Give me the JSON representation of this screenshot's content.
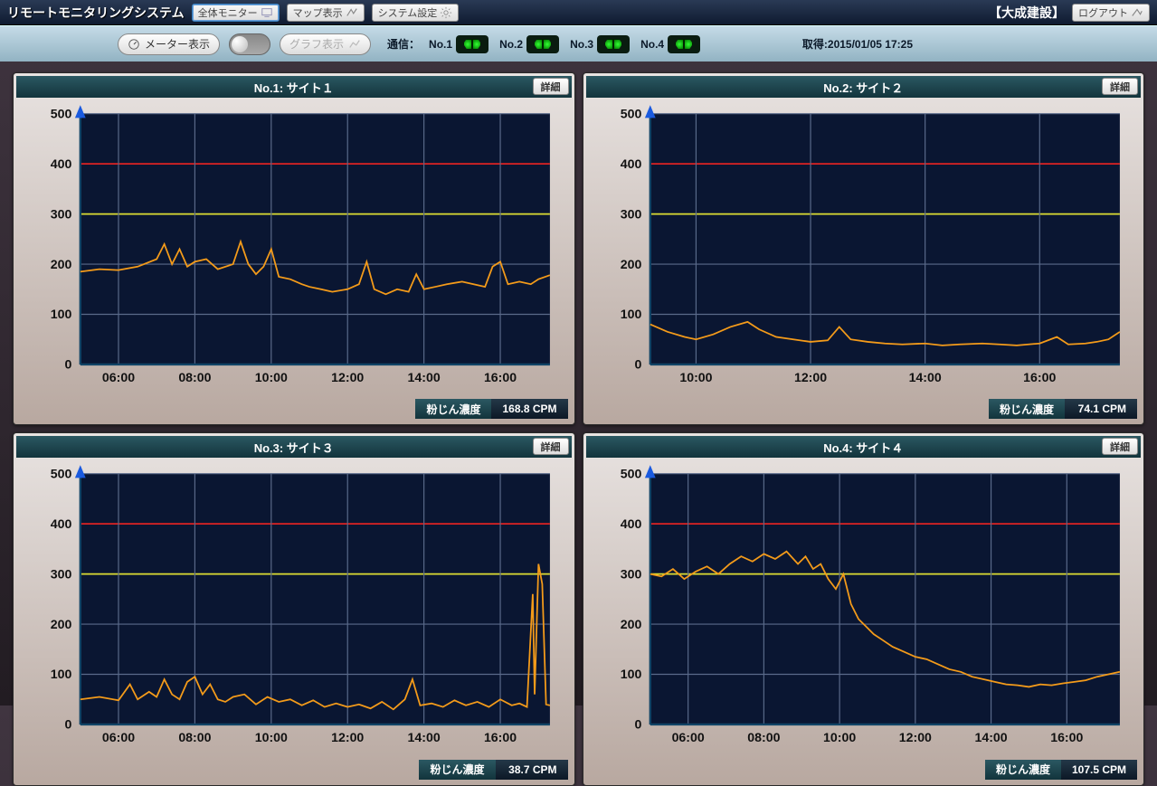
{
  "header": {
    "app_title": "リモートモニタリングシステム",
    "btn_overall": "全体モニター",
    "btn_map": "マップ表示",
    "btn_settings": "システム設定",
    "brand": "【大成建設】",
    "btn_logout": "ログアウト"
  },
  "subbar": {
    "btn_meter": "メーター表示",
    "btn_graph": "グラフ表示",
    "comm_label": "通信：",
    "acq_label": "取得:",
    "acq_time": "2015/01/05 17:25",
    "nodes": [
      {
        "label": "No.1"
      },
      {
        "label": "No.2"
      },
      {
        "label": "No.3"
      },
      {
        "label": "No.4"
      }
    ]
  },
  "panels": [
    {
      "title": "No.1: サイト１",
      "detail": "詳細",
      "metric": "粉じん濃度",
      "value": "168.8 CPM"
    },
    {
      "title": "No.2: サイト２",
      "detail": "詳細",
      "metric": "粉じん濃度",
      "value": "74.1 CPM"
    },
    {
      "title": "No.3: サイト３",
      "detail": "詳細",
      "metric": "粉じん濃度",
      "value": "38.7 CPM"
    },
    {
      "title": "No.4: サイト４",
      "detail": "詳細",
      "metric": "粉じん濃度",
      "value": "107.5 CPM"
    }
  ],
  "chart_data": [
    {
      "type": "line",
      "title": "No.1: サイト１",
      "ylabel": "",
      "xlabel": "",
      "ylim": [
        0,
        500
      ],
      "thresholds": {
        "red": 400,
        "yellow": 300
      },
      "x_ticks": [
        "06:00",
        "08:00",
        "10:00",
        "12:00",
        "14:00",
        "16:00"
      ],
      "series": [
        {
          "name": "dust",
          "data": [
            [
              5.0,
              185
            ],
            [
              5.5,
              190
            ],
            [
              6.0,
              188
            ],
            [
              6.5,
              195
            ],
            [
              7.0,
              210
            ],
            [
              7.2,
              240
            ],
            [
              7.4,
              200
            ],
            [
              7.6,
              230
            ],
            [
              7.8,
              195
            ],
            [
              8.0,
              205
            ],
            [
              8.3,
              210
            ],
            [
              8.6,
              190
            ],
            [
              9.0,
              200
            ],
            [
              9.2,
              245
            ],
            [
              9.4,
              200
            ],
            [
              9.6,
              180
            ],
            [
              9.8,
              195
            ],
            [
              10.0,
              230
            ],
            [
              10.2,
              175
            ],
            [
              10.5,
              170
            ],
            [
              10.8,
              160
            ],
            [
              11.0,
              155
            ],
            [
              11.3,
              150
            ],
            [
              11.6,
              145
            ],
            [
              12.0,
              150
            ],
            [
              12.3,
              160
            ],
            [
              12.5,
              205
            ],
            [
              12.7,
              150
            ],
            [
              13.0,
              140
            ],
            [
              13.3,
              150
            ],
            [
              13.6,
              145
            ],
            [
              13.8,
              180
            ],
            [
              14.0,
              150
            ],
            [
              14.3,
              155
            ],
            [
              14.6,
              160
            ],
            [
              15.0,
              165
            ],
            [
              15.3,
              160
            ],
            [
              15.6,
              155
            ],
            [
              15.8,
              195
            ],
            [
              16.0,
              205
            ],
            [
              16.2,
              160
            ],
            [
              16.5,
              165
            ],
            [
              16.8,
              160
            ],
            [
              17.0,
              170
            ],
            [
              17.3,
              178
            ]
          ]
        }
      ]
    },
    {
      "type": "line",
      "title": "No.2: サイト２",
      "ylabel": "",
      "xlabel": "",
      "ylim": [
        0,
        500
      ],
      "thresholds": {
        "red": 400,
        "yellow": 300
      },
      "x_ticks": [
        "10:00",
        "12:00",
        "14:00",
        "16:00"
      ],
      "series": [
        {
          "name": "dust",
          "data": [
            [
              9.2,
              80
            ],
            [
              9.5,
              65
            ],
            [
              9.8,
              55
            ],
            [
              10.0,
              50
            ],
            [
              10.3,
              60
            ],
            [
              10.6,
              75
            ],
            [
              10.9,
              85
            ],
            [
              11.1,
              70
            ],
            [
              11.4,
              55
            ],
            [
              11.7,
              50
            ],
            [
              12.0,
              45
            ],
            [
              12.3,
              48
            ],
            [
              12.5,
              75
            ],
            [
              12.7,
              50
            ],
            [
              13.0,
              45
            ],
            [
              13.3,
              42
            ],
            [
              13.6,
              40
            ],
            [
              14.0,
              42
            ],
            [
              14.3,
              38
            ],
            [
              14.6,
              40
            ],
            [
              15.0,
              42
            ],
            [
              15.3,
              40
            ],
            [
              15.6,
              38
            ],
            [
              16.0,
              42
            ],
            [
              16.3,
              55
            ],
            [
              16.5,
              40
            ],
            [
              16.8,
              42
            ],
            [
              17.0,
              45
            ],
            [
              17.2,
              50
            ],
            [
              17.4,
              65
            ]
          ]
        }
      ]
    },
    {
      "type": "line",
      "title": "No.3: サイト３",
      "ylabel": "",
      "xlabel": "",
      "ylim": [
        0,
        500
      ],
      "thresholds": {
        "red": 400,
        "yellow": 300
      },
      "x_ticks": [
        "06:00",
        "08:00",
        "10:00",
        "12:00",
        "14:00",
        "16:00"
      ],
      "series": [
        {
          "name": "dust",
          "data": [
            [
              5.0,
              50
            ],
            [
              5.5,
              55
            ],
            [
              6.0,
              48
            ],
            [
              6.3,
              80
            ],
            [
              6.5,
              50
            ],
            [
              6.8,
              65
            ],
            [
              7.0,
              55
            ],
            [
              7.2,
              90
            ],
            [
              7.4,
              60
            ],
            [
              7.6,
              50
            ],
            [
              7.8,
              85
            ],
            [
              8.0,
              95
            ],
            [
              8.2,
              60
            ],
            [
              8.4,
              80
            ],
            [
              8.6,
              50
            ],
            [
              8.8,
              45
            ],
            [
              9.0,
              55
            ],
            [
              9.3,
              60
            ],
            [
              9.6,
              40
            ],
            [
              9.9,
              55
            ],
            [
              10.2,
              45
            ],
            [
              10.5,
              50
            ],
            [
              10.8,
              38
            ],
            [
              11.1,
              48
            ],
            [
              11.4,
              35
            ],
            [
              11.7,
              42
            ],
            [
              12.0,
              35
            ],
            [
              12.3,
              40
            ],
            [
              12.6,
              32
            ],
            [
              12.9,
              45
            ],
            [
              13.2,
              30
            ],
            [
              13.5,
              50
            ],
            [
              13.7,
              90
            ],
            [
              13.9,
              38
            ],
            [
              14.2,
              42
            ],
            [
              14.5,
              35
            ],
            [
              14.8,
              48
            ],
            [
              15.1,
              38
            ],
            [
              15.4,
              45
            ],
            [
              15.7,
              35
            ],
            [
              16.0,
              50
            ],
            [
              16.3,
              38
            ],
            [
              16.5,
              42
            ],
            [
              16.7,
              35
            ],
            [
              16.85,
              260
            ],
            [
              16.9,
              60
            ],
            [
              17.0,
              320
            ],
            [
              17.1,
              280
            ],
            [
              17.2,
              40
            ],
            [
              17.3,
              38
            ]
          ]
        }
      ]
    },
    {
      "type": "line",
      "title": "No.4: サイト４",
      "ylabel": "",
      "xlabel": "",
      "ylim": [
        0,
        500
      ],
      "thresholds": {
        "red": 400,
        "yellow": 300
      },
      "x_ticks": [
        "06:00",
        "08:00",
        "10:00",
        "12:00",
        "14:00",
        "16:00"
      ],
      "series": [
        {
          "name": "dust",
          "data": [
            [
              5.0,
              300
            ],
            [
              5.3,
              295
            ],
            [
              5.6,
              310
            ],
            [
              5.9,
              290
            ],
            [
              6.2,
              305
            ],
            [
              6.5,
              315
            ],
            [
              6.8,
              300
            ],
            [
              7.1,
              320
            ],
            [
              7.4,
              335
            ],
            [
              7.7,
              325
            ],
            [
              8.0,
              340
            ],
            [
              8.3,
              330
            ],
            [
              8.6,
              345
            ],
            [
              8.9,
              320
            ],
            [
              9.1,
              335
            ],
            [
              9.3,
              310
            ],
            [
              9.5,
              320
            ],
            [
              9.7,
              290
            ],
            [
              9.9,
              270
            ],
            [
              10.1,
              300
            ],
            [
              10.3,
              240
            ],
            [
              10.5,
              210
            ],
            [
              10.7,
              195
            ],
            [
              10.9,
              180
            ],
            [
              11.1,
              170
            ],
            [
              11.4,
              155
            ],
            [
              11.7,
              145
            ],
            [
              12.0,
              135
            ],
            [
              12.3,
              130
            ],
            [
              12.6,
              120
            ],
            [
              12.9,
              110
            ],
            [
              13.2,
              105
            ],
            [
              13.5,
              95
            ],
            [
              13.8,
              90
            ],
            [
              14.1,
              85
            ],
            [
              14.4,
              80
            ],
            [
              14.7,
              78
            ],
            [
              15.0,
              75
            ],
            [
              15.3,
              80
            ],
            [
              15.6,
              78
            ],
            [
              15.9,
              82
            ],
            [
              16.2,
              85
            ],
            [
              16.5,
              88
            ],
            [
              16.8,
              95
            ],
            [
              17.1,
              100
            ],
            [
              17.4,
              105
            ]
          ]
        }
      ]
    }
  ]
}
